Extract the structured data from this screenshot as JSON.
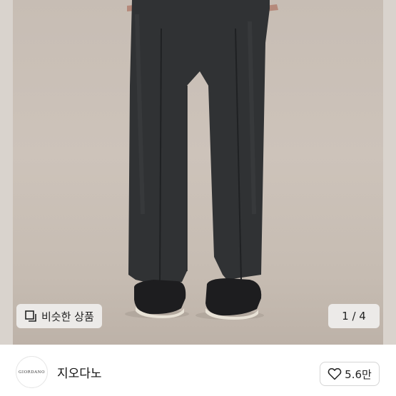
{
  "gallery": {
    "similar_products_label": "비슷한 상품",
    "counter": "1 / 4",
    "current_index": 1,
    "total": 4
  },
  "shop": {
    "logo_text": "GIORDANO",
    "name": "지오다노",
    "like_count": "5.6만"
  },
  "colors": {
    "photo_background": "#c9bfb6",
    "trousers": "#2f3133",
    "chip_background": "#f5f5f5"
  }
}
